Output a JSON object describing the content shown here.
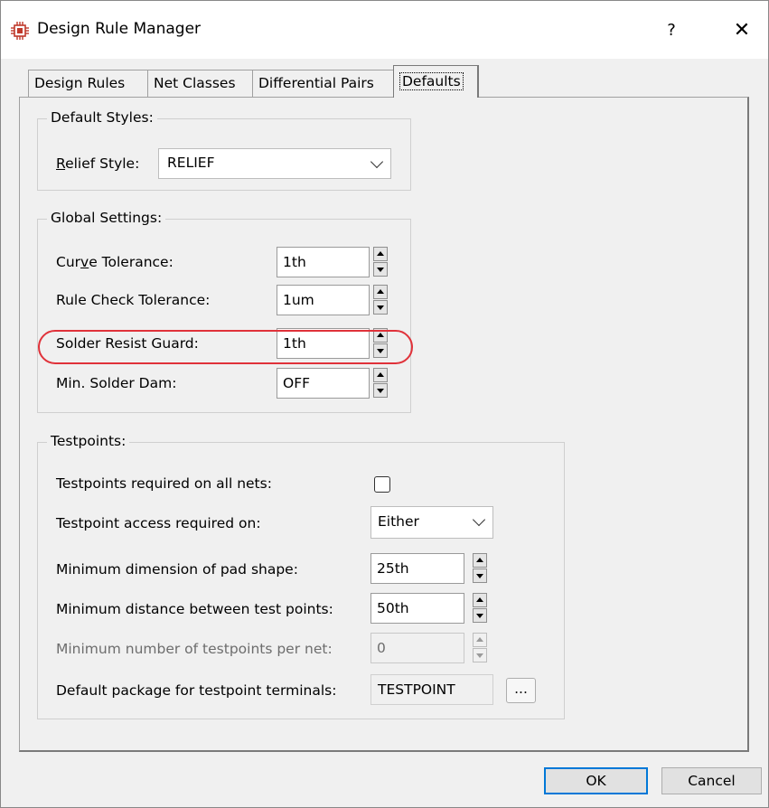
{
  "window": {
    "title": "Design Rule Manager",
    "help": "?",
    "close": "✕"
  },
  "tabs": [
    "Design Rules",
    "Net Classes",
    "Differential Pairs",
    "Defaults"
  ],
  "default_styles": {
    "title": "Default Styles:",
    "relief_label_u": "R",
    "relief_label_rest": "elief Style:",
    "relief_value": "RELIEF"
  },
  "global_settings": {
    "title": "Global Settings:",
    "curve_label_pre": "Cur",
    "curve_label_u": "v",
    "curve_label_post": "e Tolerance:",
    "curve_value": "1th",
    "rule_check_label": "Rule Check Tolerance:",
    "rule_check_value": "1um",
    "solder_resist_label": "Solder Resist Guard:",
    "solder_resist_value": "1th",
    "min_solder_dam_label": "Min. Solder Dam:",
    "min_solder_dam_value": "OFF"
  },
  "testpoints": {
    "title": "Testpoints:",
    "required_label": "Testpoints required on all nets:",
    "access_label": "Testpoint access required on:",
    "access_value": "Either",
    "min_dim_label": "Minimum dimension of pad shape:",
    "min_dim_value": "25th",
    "min_dist_label": "Minimum distance between test points:",
    "min_dist_value": "50th",
    "min_num_label": "Minimum number of testpoints per net:",
    "min_num_value": "0",
    "default_pkg_label": "Default package for testpoint terminals:",
    "default_pkg_value": "TESTPOINT",
    "browse_label": "..."
  },
  "buttons": {
    "ok": "OK",
    "cancel": "Cancel"
  },
  "colors": {
    "highlight": "#e0323a",
    "default_button_border": "#0078d7"
  }
}
